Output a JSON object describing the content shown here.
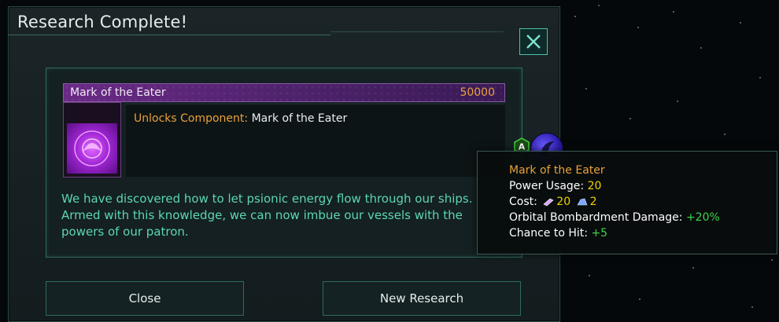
{
  "dialog": {
    "title": "Research Complete!",
    "close_icon": "close-icon"
  },
  "tech": {
    "name": "Mark of the Eater",
    "cost": "50000",
    "unlock_label": "Unlocks Component:",
    "unlock_value": "Mark of the Eater",
    "badge": "A"
  },
  "description": "We have discovered how to let psionic energy flow through our ships. Armed with this knowledge, we can now imbue our vessels with the powers of our patron.",
  "buttons": {
    "close": "Close",
    "new_research": "New Research"
  },
  "tooltip": {
    "title": "Mark of the Eater",
    "power_label": "Power Usage:",
    "power_value": "20",
    "cost_label": "Cost:",
    "cost_alloys": "20",
    "cost_rare": "2",
    "bombard_label": "Orbital Bombardment Damage:",
    "bombard_value": "+20%",
    "hit_label": "Chance to Hit:",
    "hit_value": "+5"
  },
  "colors": {
    "accent_teal": "#5cd6b4",
    "cost_orange": "#e9a13a",
    "positive_green": "#3fd24c",
    "value_yellow": "#f3d000",
    "psionic_purple": "#a126d6"
  }
}
